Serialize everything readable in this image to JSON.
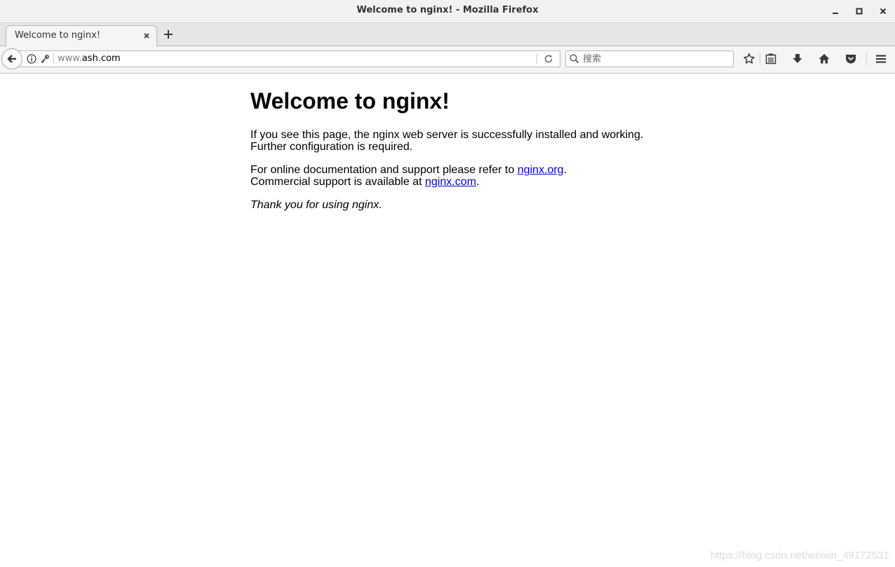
{
  "window": {
    "title": "Welcome to nginx! - Mozilla Firefox"
  },
  "tabs": [
    {
      "label": "Welcome to nginx!",
      "active": true
    }
  ],
  "navbar": {
    "url_prefix": "www.",
    "url_host": "ash.com",
    "search_placeholder": "搜索"
  },
  "icons": {
    "minimize": "minimize-icon",
    "maximize": "maximize-icon",
    "close": "close-icon",
    "tab_close": "close-icon",
    "new_tab": "plus-icon",
    "back": "back-arrow-icon",
    "site_info": "info-icon",
    "key": "key-icon",
    "reload": "reload-icon",
    "search": "search-icon",
    "bookmark": "star-icon",
    "reading_list": "clipboard-icon",
    "downloads": "download-arrow-icon",
    "home": "home-icon",
    "pocket": "pocket-icon",
    "menu": "hamburger-icon"
  },
  "page": {
    "heading": "Welcome to nginx!",
    "para1_line1": "If you see this page, the nginx web server is successfully installed and working.",
    "para1_line2": "Further configuration is required.",
    "para2_text1": "For online documentation and support please refer to ",
    "para2_link1": "nginx.org",
    "para2_text2": ".",
    "para2_text3": "Commercial support is available at ",
    "para2_link2": "nginx.com",
    "para2_text4": ".",
    "para3": "Thank you for using nginx."
  },
  "watermark": "https://blog.csdn.net/weixin_49172531",
  "colors": {
    "link": "#0000ee",
    "chrome": "#f5f5f5",
    "titlebar": "#f1f1f1"
  }
}
